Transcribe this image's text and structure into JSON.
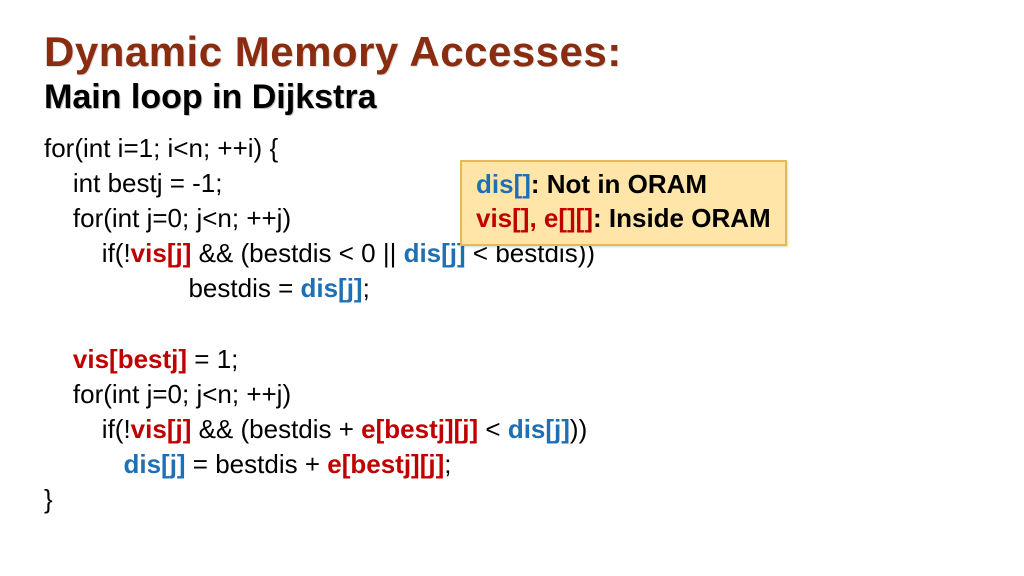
{
  "title": "Dynamic Memory Accesses:",
  "subtitle": "Main loop in Dijkstra",
  "legend": {
    "line1_a": "dis[]",
    "line1_b": ": Not in ORAM",
    "line2_a": "vis[], e[][]",
    "line2_b": ": Inside ORAM"
  },
  "code": {
    "l1": "for(int i=1; i<n; ++i) {",
    "l2": "    int bestj = -1;",
    "l3": "    for(int j=0; j<n; ++j)",
    "l4_a": "        if(!",
    "l4_vis": "vis[j]",
    "l4_b": " && (bestdis < 0 || ",
    "l4_dis": "dis[j]",
    "l4_c": " < bestdis))",
    "l5_a": "                    bestdis = ",
    "l5_dis": "dis[j]",
    "l5_b": ";",
    "blank": "",
    "l6_a": "    ",
    "l6_vis": "vis[bestj]",
    "l6_b": " = 1;",
    "l7": "    for(int j=0; j<n; ++j)",
    "l8_a": "        if(!",
    "l8_vis": "vis[j]",
    "l8_b": " && (bestdis + ",
    "l8_e": "e[bestj][j]",
    "l8_c": " < ",
    "l8_dis": "dis[j]",
    "l8_d": "))",
    "l9_a": "           ",
    "l9_dis": "dis[j]",
    "l9_b": " = bestdis + ",
    "l9_e": "e[bestj][j]",
    "l9_c": ";",
    "l10": "}"
  }
}
